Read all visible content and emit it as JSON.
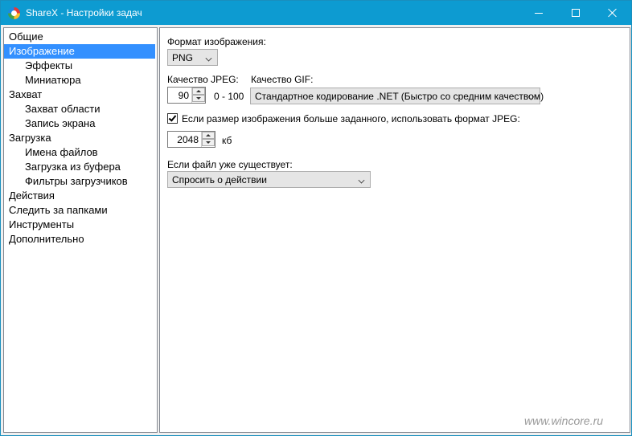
{
  "window": {
    "title": "ShareX - Настройки задач"
  },
  "tree": {
    "items": [
      {
        "label": "Общие",
        "level": 0,
        "selected": false
      },
      {
        "label": "Изображение",
        "level": 0,
        "selected": true
      },
      {
        "label": "Эффекты",
        "level": 1,
        "selected": false
      },
      {
        "label": "Миниатюра",
        "level": 1,
        "selected": false
      },
      {
        "label": "Захват",
        "level": 0,
        "selected": false
      },
      {
        "label": "Захват области",
        "level": 1,
        "selected": false
      },
      {
        "label": "Запись экрана",
        "level": 1,
        "selected": false
      },
      {
        "label": "Загрузка",
        "level": 0,
        "selected": false
      },
      {
        "label": "Имена файлов",
        "level": 1,
        "selected": false
      },
      {
        "label": "Загрузка из буфера",
        "level": 1,
        "selected": false
      },
      {
        "label": "Фильтры загрузчиков",
        "level": 1,
        "selected": false
      },
      {
        "label": "Действия",
        "level": 0,
        "selected": false
      },
      {
        "label": "Следить за папками",
        "level": 0,
        "selected": false
      },
      {
        "label": "Инструменты",
        "level": 0,
        "selected": false
      },
      {
        "label": "Дополнительно",
        "level": 0,
        "selected": false
      }
    ]
  },
  "image_settings": {
    "format_label": "Формат изображения:",
    "format_value": "PNG",
    "jpeg_quality_label": "Качество JPEG:",
    "jpeg_quality_value": "90",
    "jpeg_quality_range": "0 - 100",
    "gif_quality_label": "Качество GIF:",
    "gif_quality_value": "Стандартное кодирование .NET (Быстро со средним качеством)",
    "size_limit_checkbox_label": "Если размер изображения больше заданного, использовать формат JPEG:",
    "size_limit_checked": true,
    "size_limit_value": "2048",
    "size_limit_unit": "кб",
    "file_exists_label": "Если файл уже существует:",
    "file_exists_value": "Спросить о действии"
  },
  "watermark": "www.wincore.ru",
  "colors": {
    "titlebar": "#0d9bd1",
    "selection": "#3390ff"
  },
  "icons": {
    "app": "sharex-logo-icon",
    "minimize": "minimize-icon",
    "maximize": "maximize-icon",
    "close": "close-icon"
  }
}
